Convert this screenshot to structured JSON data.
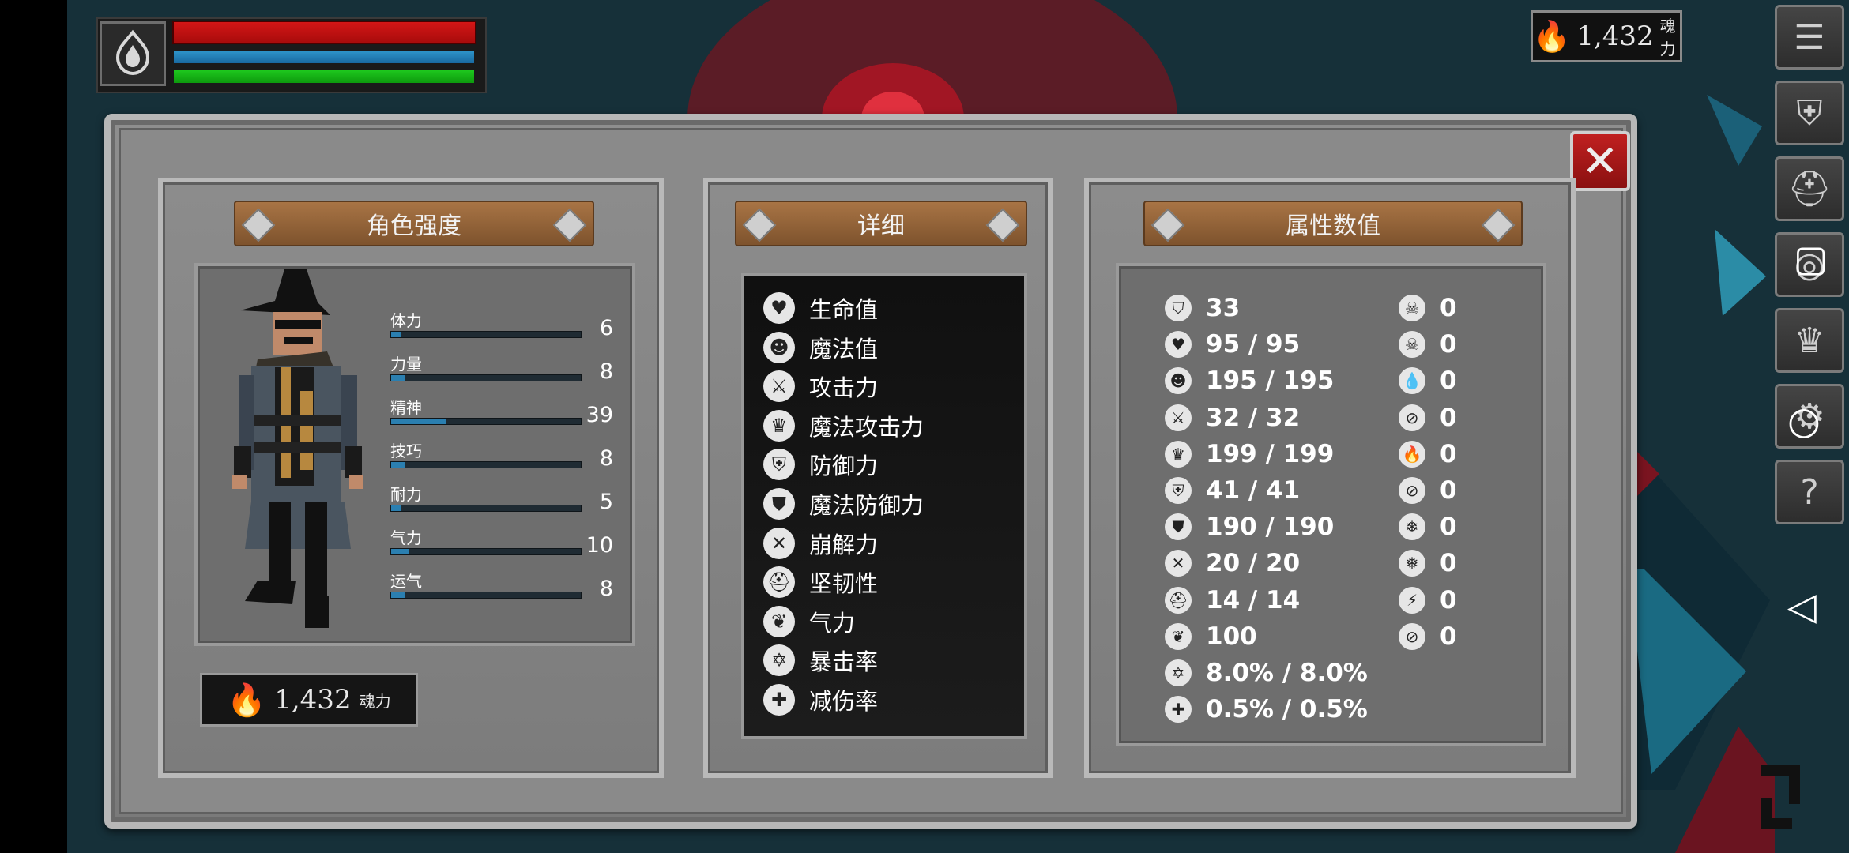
{
  "hud": {
    "health_fraction": 1.0,
    "mana_fraction": 1.0,
    "stamina_fraction": 1.0
  },
  "currency": {
    "value": "1,432",
    "label": "魂力"
  },
  "panels": {
    "strength_title": "角色强度",
    "details_title": "详细",
    "attributes_title": "属性数值"
  },
  "stats": [
    {
      "label": "体力",
      "value": "6",
      "fill": 0.05
    },
    {
      "label": "力量",
      "value": "8",
      "fill": 0.07
    },
    {
      "label": "精神",
      "value": "39",
      "fill": 0.29
    },
    {
      "label": "技巧",
      "value": "8",
      "fill": 0.07
    },
    {
      "label": "耐力",
      "value": "5",
      "fill": 0.05
    },
    {
      "label": "气力",
      "value": "10",
      "fill": 0.09
    },
    {
      "label": "运气",
      "value": "8",
      "fill": 0.07
    }
  ],
  "details": [
    {
      "label": "生命值",
      "icon": "heart-icon",
      "glyph": "♥"
    },
    {
      "label": "魔法值",
      "icon": "head-icon",
      "glyph": "☻"
    },
    {
      "label": "攻击力",
      "icon": "sword-icon",
      "glyph": "⚔"
    },
    {
      "label": "魔法攻击力",
      "icon": "magic-crown-icon",
      "glyph": "♛"
    },
    {
      "label": "防御力",
      "icon": "shield-icon",
      "glyph": "⛨"
    },
    {
      "label": "魔法防御力",
      "icon": "magic-shield-icon",
      "glyph": "⛊"
    },
    {
      "label": "崩解力",
      "icon": "break-icon",
      "glyph": "✕"
    },
    {
      "label": "坚韧性",
      "icon": "helmet-icon",
      "glyph": "⛑"
    },
    {
      "label": "气力",
      "icon": "lungs-icon",
      "glyph": "❦"
    },
    {
      "label": "暴击率",
      "icon": "critical-star-icon",
      "glyph": "✡"
    },
    {
      "label": "减伤率",
      "icon": "damage-reduction-icon",
      "glyph": "✚"
    }
  ],
  "attributes_left": [
    {
      "value": "33",
      "icon": "armor-icon",
      "glyph": "⛉"
    },
    {
      "value": "95 / 95",
      "icon": "heart-icon",
      "glyph": "♥"
    },
    {
      "value": "195 / 195",
      "icon": "head-icon",
      "glyph": "☻"
    },
    {
      "value": "32 / 32",
      "icon": "sword-icon",
      "glyph": "⚔"
    },
    {
      "value": "199 / 199",
      "icon": "magic-crown-icon",
      "glyph": "♛"
    },
    {
      "value": "41 / 41",
      "icon": "shield-icon",
      "glyph": "⛨"
    },
    {
      "value": "190 / 190",
      "icon": "magic-shield-icon",
      "glyph": "⛊"
    },
    {
      "value": "20 / 20",
      "icon": "break-icon",
      "glyph": "✕"
    },
    {
      "value": "14 / 14",
      "icon": "helmet-icon",
      "glyph": "⛑"
    },
    {
      "value": "100",
      "icon": "lungs-icon",
      "glyph": "❦"
    },
    {
      "value": "8.0% / 8.0%",
      "icon": "critical-star-icon",
      "glyph": "✡"
    },
    {
      "value": "0.5% / 0.5%",
      "icon": "damage-reduction-icon",
      "glyph": "✚"
    }
  ],
  "attributes_right": [
    {
      "value": "0",
      "icon": "skull-icon",
      "glyph": "☠"
    },
    {
      "value": "0",
      "icon": "skull-resist-icon",
      "glyph": "☠"
    },
    {
      "value": "0",
      "icon": "blood-drop-icon",
      "glyph": "💧"
    },
    {
      "value": "0",
      "icon": "bleed-resist-icon",
      "glyph": "⊘"
    },
    {
      "value": "0",
      "icon": "fire-icon",
      "glyph": "🔥"
    },
    {
      "value": "0",
      "icon": "fire-resist-icon",
      "glyph": "⊘"
    },
    {
      "value": "0",
      "icon": "frost-icon",
      "glyph": "❄"
    },
    {
      "value": "0",
      "icon": "frost-resist-icon",
      "glyph": "❅"
    },
    {
      "value": "0",
      "icon": "lightning-icon",
      "glyph": "⚡"
    },
    {
      "value": "0",
      "icon": "lightning-resist-icon",
      "glyph": "⊘"
    }
  ],
  "menu": [
    {
      "name": "menu-list-button",
      "glyph": "☰"
    },
    {
      "name": "character-button",
      "glyph": "⛨"
    },
    {
      "name": "equipment-button",
      "glyph": "⛑"
    },
    {
      "name": "world-button",
      "glyph": "◎"
    },
    {
      "name": "crown-button",
      "glyph": "♛"
    },
    {
      "name": "settings-button",
      "glyph": "⚙"
    },
    {
      "name": "help-button",
      "glyph": "?"
    }
  ]
}
